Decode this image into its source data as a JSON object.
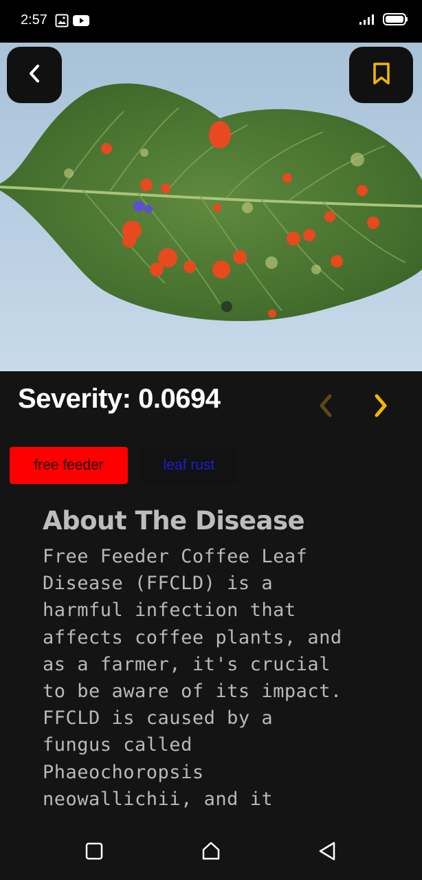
{
  "status_bar": {
    "time": "2:57",
    "icons_left": [
      "image-icon",
      "youtube-icon"
    ],
    "icons_right": [
      "signal-icon",
      "battery-icon"
    ]
  },
  "hero": {
    "image": "coffee-leaf-photo",
    "back_icon": "chevron-left-icon",
    "bookmark_icon": "bookmark-icon",
    "accent_color": "#f5b800"
  },
  "severity": {
    "label": "Severity: 0.0694",
    "prev_icon": "chevron-left-icon",
    "next_icon": "chevron-right-icon"
  },
  "tags": [
    {
      "label": "free feeder",
      "color": "#ff0000",
      "text_color": "#1a0000"
    },
    {
      "label": "leaf rust",
      "color": "#121212",
      "text_color": "#1d1dd4"
    }
  ],
  "about": {
    "title": "About The Disease",
    "text": "Free Feeder Coffee Leaf\nDisease (FFCLD) is a\nharmful infection that\naffects coffee plants, and\nas a farmer, it's crucial\nto be aware of its impact.\nFFCLD is caused by a\nfungus called\nPhaeochoropsis\nneowallichii, and it"
  },
  "bottom_nav": {
    "items": [
      "recents-icon",
      "home-icon",
      "back-icon"
    ]
  }
}
